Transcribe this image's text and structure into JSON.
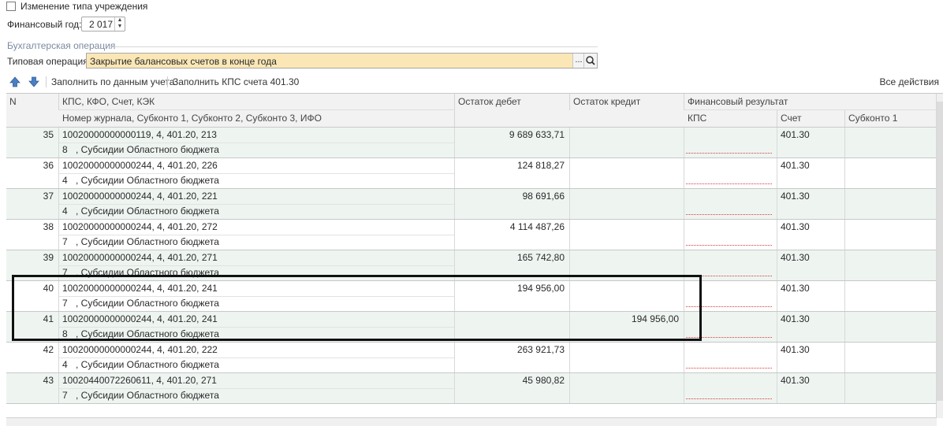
{
  "form": {
    "type_change_label": "Изменение типа учреждения",
    "fin_year_label": "Финансовый год:",
    "fin_year_value": "2 017",
    "group_title": "Бухгалтерская операция",
    "operation_label": "Типовая операция:",
    "operation_value": "Закрытие балансовых счетов в конце года",
    "operation_choose": "..."
  },
  "toolbar": {
    "fill_by_accounting": "Заполнить по данным учета",
    "fill_kps": "Заполнить КПС счета 401.30",
    "all_actions": "Все действия"
  },
  "table": {
    "headers": {
      "n": "N",
      "kps": "КПС, КФО, Счет, КЭК",
      "kps_sub": "Номер журнала, Субконто 1, Субконто 2, Субконто 3, ИФО",
      "debit": "Остаток дебет",
      "credit": "Остаток кредит",
      "fin_result": "Финансовый результат",
      "fr_kps": "КПС",
      "fr_account": "Счет",
      "fr_subkonto1": "Субконто 1"
    },
    "rows": [
      {
        "n": "35",
        "kps": "10020000000000119, 4, 401.20, 213",
        "journal": "8",
        "subkonto": ", Субсидии Областного бюджета",
        "debit": "9 689 633,71",
        "credit": "",
        "account": "401.30"
      },
      {
        "n": "36",
        "kps": "10020000000000244, 4, 401.20, 226",
        "journal": "4",
        "subkonto": ", Субсидии Областного бюджета",
        "debit": "124 818,27",
        "credit": "",
        "account": "401.30"
      },
      {
        "n": "37",
        "kps": "10020000000000244, 4, 401.20, 221",
        "journal": "4",
        "subkonto": ", Субсидии Областного бюджета",
        "debit": "98 691,66",
        "credit": "",
        "account": "401.30"
      },
      {
        "n": "38",
        "kps": "10020000000000244, 4, 401.20, 272",
        "journal": "7",
        "subkonto": ", Субсидии Областного бюджета",
        "debit": "4 114 487,26",
        "credit": "",
        "account": "401.30"
      },
      {
        "n": "39",
        "kps": "10020000000000244, 4, 401.20, 271",
        "journal": "7",
        "subkonto": ", Субсидии Областного бюджета",
        "debit": "165 742,80",
        "credit": "",
        "account": "401.30"
      },
      {
        "n": "40",
        "kps": "10020000000000244, 4, 401.20, 241",
        "journal": "7",
        "subkonto": ", Субсидии Областного бюджета",
        "debit": "194 956,00",
        "credit": "",
        "account": "401.30"
      },
      {
        "n": "41",
        "kps": "10020000000000244, 4, 401.20, 241",
        "journal": "8",
        "subkonto": ", Субсидии Областного бюджета",
        "debit": "",
        "credit": "194 956,00",
        "account": "401.30"
      },
      {
        "n": "42",
        "kps": "10020000000000244, 4, 401.20, 222",
        "journal": "4",
        "subkonto": ", Субсидии Областного бюджета",
        "debit": "263 921,73",
        "credit": "",
        "account": "401.30"
      },
      {
        "n": "43",
        "kps": "10020440072260611, 4, 401.20, 271",
        "journal": "7",
        "subkonto": ", Субсидии Областного бюджета",
        "debit": "45 980,82",
        "credit": "",
        "account": "401.30"
      }
    ]
  },
  "colors": {
    "operation_field_bg": "#fbe7b6",
    "alt_row_bg": "#eef5f1",
    "group_title": "#7b8aa0",
    "required_underline": "#d23b3b",
    "arrow_icon": "#4a7fc1"
  }
}
